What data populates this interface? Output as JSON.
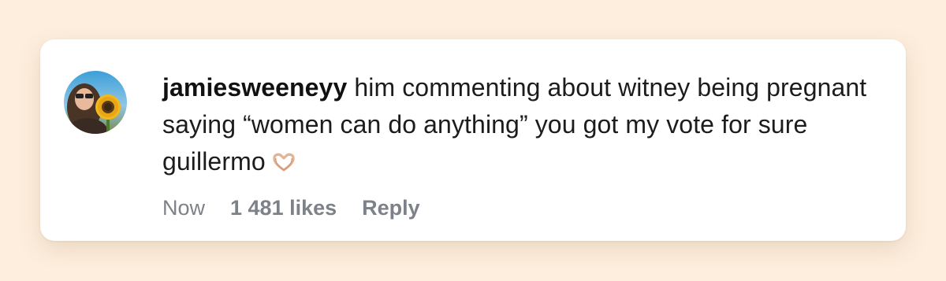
{
  "comment": {
    "username": "jamiesweeneyy",
    "text": "him commenting about witney being pregnant saying “women can do anything” you got my vote for sure guillermo",
    "emoji": "heart-hands-icon",
    "time": "Now",
    "likes": "1 481 likes",
    "reply_label": "Reply"
  },
  "colors": {
    "background": "#fdeedd",
    "card": "#ffffff",
    "text": "#1c1c1c",
    "meta": "#7d8188"
  }
}
